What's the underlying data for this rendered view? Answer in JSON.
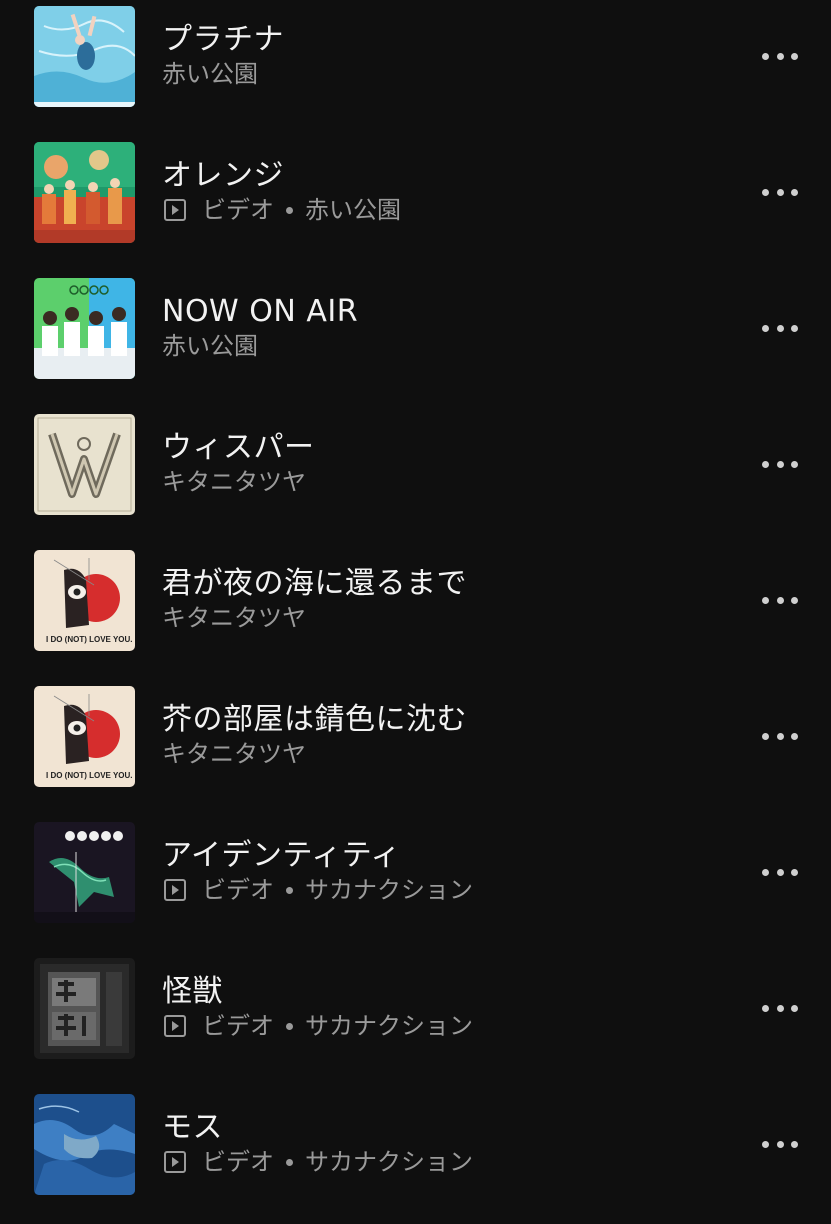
{
  "tracks": [
    {
      "title": "プラチナ",
      "is_video": false,
      "video_label": "",
      "artist": "赤い公園",
      "art": "swimmer-art"
    },
    {
      "title": "オレンジ",
      "is_video": true,
      "video_label": "ビデオ",
      "artist": "赤い公園",
      "art": "orange-art"
    },
    {
      "title": "NOW ON AIR",
      "is_video": false,
      "video_label": "",
      "artist": "赤い公園",
      "art": "band-art"
    },
    {
      "title": "ウィスパー",
      "is_video": false,
      "video_label": "",
      "artist": "キタニタツヤ",
      "art": "whisper-art"
    },
    {
      "title": "君が夜の海に還るまで",
      "is_video": false,
      "video_label": "",
      "artist": "キタニタツヤ",
      "art": "i-do-not-love-you-art"
    },
    {
      "title": "芥の部屋は錆色に沈む",
      "is_video": false,
      "video_label": "",
      "artist": "キタニタツヤ",
      "art": "i-do-not-love-you-art"
    },
    {
      "title": "アイデンティティ",
      "is_video": true,
      "video_label": "ビデオ",
      "artist": "サカナクション",
      "art": "identity-art"
    },
    {
      "title": "怪獣",
      "is_video": true,
      "video_label": "ビデオ",
      "artist": "サカナクション",
      "art": "kaiju-art"
    },
    {
      "title": "モス",
      "is_video": true,
      "video_label": "ビデオ",
      "artist": "サカナクション",
      "art": "moss-art"
    }
  ],
  "colors": {
    "background": "#0f0f0f",
    "title": "#f2f2f2",
    "subtitle": "#9a9a9a",
    "more_dots": "#cfcfcf"
  },
  "icons": {
    "video": "video-play-icon",
    "more": "more-options-icon"
  }
}
